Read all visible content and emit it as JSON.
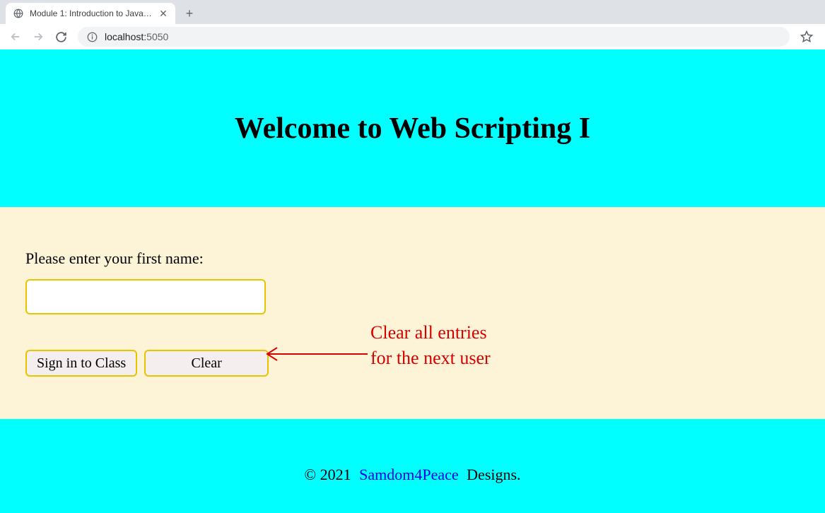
{
  "browser": {
    "tab_title": "Module 1: Introduction to JavaSc",
    "url_host": "localhost:",
    "url_port": "5050"
  },
  "page": {
    "heading": "Welcome to Web Scripting I",
    "form": {
      "label": "Please enter your first name:",
      "input_value": "",
      "signin_button": "Sign in to Class",
      "clear_button": "Clear"
    },
    "annotation": {
      "text": "Clear all entries\nfor the next user"
    },
    "footer": {
      "copyright_pre": "© 2021 ",
      "link_text": "Samdom4Peace",
      "copyright_post": " Designs."
    }
  }
}
